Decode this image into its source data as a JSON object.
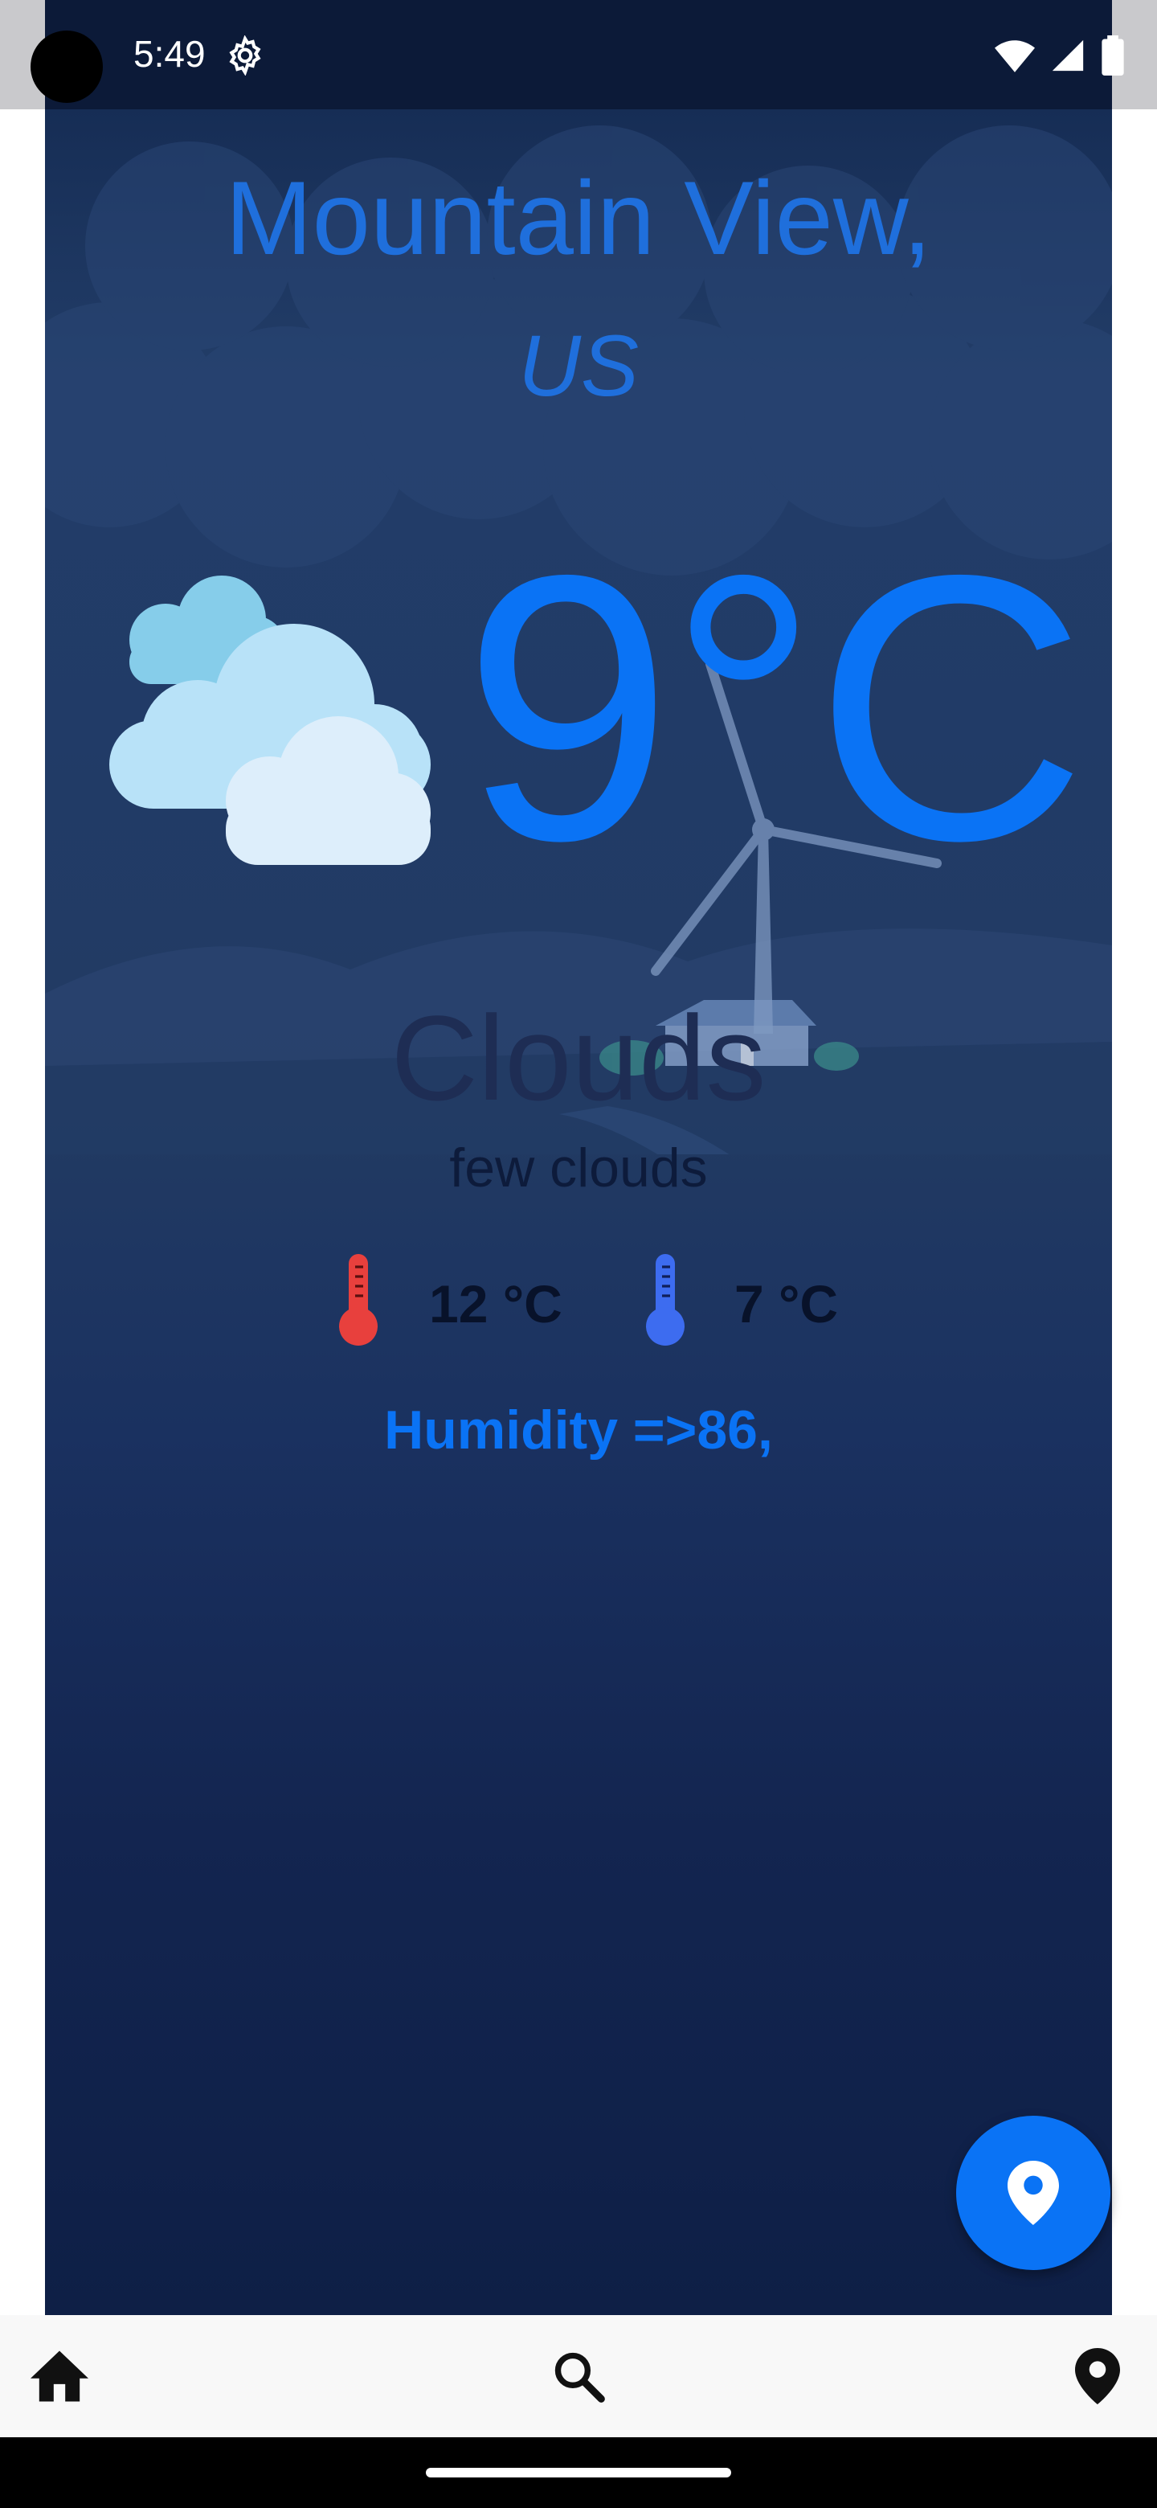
{
  "status_bar": {
    "time": "5:49",
    "settings_icon": "gear-icon",
    "wifi_icon": "wifi-icon",
    "signal_icon": "signal-icon",
    "battery_icon": "battery-icon"
  },
  "location": {
    "city": "Mountain View,",
    "country": "US"
  },
  "current": {
    "icon": "cloudy-icon",
    "temperature": "9°C",
    "condition": "Clouds",
    "description": "few clouds"
  },
  "range": {
    "max": "12 °C",
    "min": "7 °C",
    "max_icon": "thermometer-hot-icon",
    "min_icon": "thermometer-cold-icon"
  },
  "humidity": "Humidity =>86,",
  "fab_icon": "location-pin-icon",
  "bottom_nav": [
    {
      "icon": "home-icon"
    },
    {
      "icon": "search-icon"
    },
    {
      "icon": "location-pin-icon"
    }
  ],
  "colors": {
    "accent": "#0a73f5",
    "title": "#1f6fdc",
    "background": "#1a3160",
    "hot": "#e8403d",
    "cold": "#3d6cf0"
  }
}
